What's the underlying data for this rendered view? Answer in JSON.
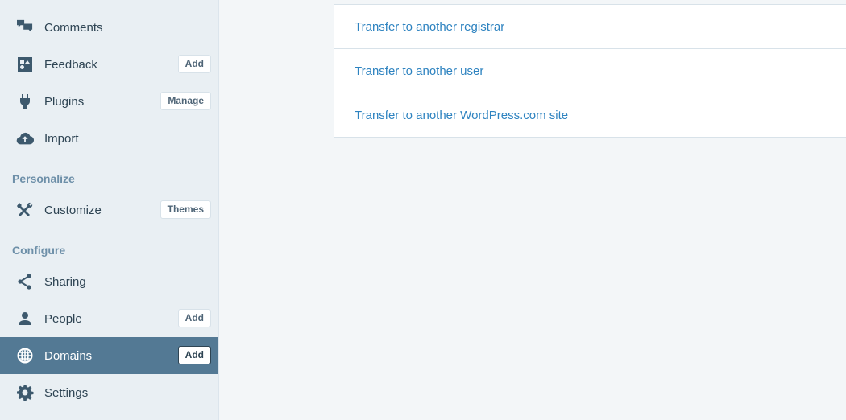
{
  "sidebar": {
    "items": [
      {
        "label": "Comments",
        "icon": "comments-icon"
      },
      {
        "label": "Feedback",
        "icon": "feedback-icon",
        "button": "Add"
      },
      {
        "label": "Plugins",
        "icon": "plug-icon",
        "button": "Manage"
      },
      {
        "label": "Import",
        "icon": "cloud-upload-icon"
      }
    ],
    "personalize": {
      "heading": "Personalize",
      "items": [
        {
          "label": "Customize",
          "icon": "tools-icon",
          "button": "Themes"
        }
      ]
    },
    "configure": {
      "heading": "Configure",
      "items": [
        {
          "label": "Sharing",
          "icon": "share-icon"
        },
        {
          "label": "People",
          "icon": "person-icon",
          "button": "Add"
        },
        {
          "label": "Domains",
          "icon": "globe-icon",
          "button": "Add",
          "active": true
        },
        {
          "label": "Settings",
          "icon": "gear-icon"
        }
      ]
    }
  },
  "main": {
    "transfer_options": [
      {
        "label": "Transfer to another registrar"
      },
      {
        "label": "Transfer to another user"
      },
      {
        "label": "Transfer to another WordPress.com site"
      }
    ]
  },
  "colors": {
    "sidebar_bg": "#e9eff3",
    "active_bg": "#537994",
    "link": "#2e83c0",
    "section_heading": "#6d8fa8"
  }
}
